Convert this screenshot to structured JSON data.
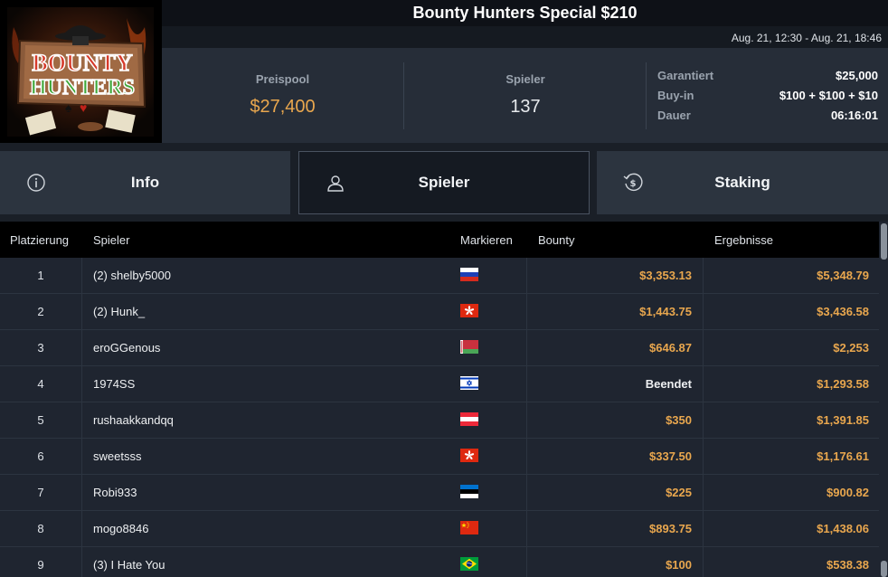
{
  "tournament": {
    "title": "Bounty Hunters Special $210",
    "dates": "Aug. 21, 12:30 - Aug. 21, 18:46",
    "logo_text": "BOUNTY HUNTERS"
  },
  "stats": {
    "prizepool_label": "Preispool",
    "prizepool_value": "$27,400",
    "players_label": "Spieler",
    "players_value": "137"
  },
  "details": [
    {
      "key": "Garantiert",
      "value": "$25,000"
    },
    {
      "key": "Buy-in",
      "value": "$100 + $100 + $10"
    },
    {
      "key": "Dauer",
      "value": "06:16:01"
    }
  ],
  "tabs": [
    {
      "label": "Info",
      "icon": "info-icon"
    },
    {
      "label": "Spieler",
      "icon": "user-icon",
      "active": true
    },
    {
      "label": "Staking",
      "icon": "staking-icon"
    }
  ],
  "table": {
    "headers": {
      "rank": "Platzierung",
      "player": "Spieler",
      "flag": "Markieren",
      "bounty": "Bounty",
      "results": "Ergebnisse"
    },
    "rows": [
      {
        "rank": "1",
        "player": "(2) shelby5000",
        "flag": "russia",
        "bounty": "$3,353.13",
        "result": "$5,348.79"
      },
      {
        "rank": "2",
        "player": "(2) Hunk_",
        "flag": "hong-kong",
        "bounty": "$1,443.75",
        "result": "$3,436.58"
      },
      {
        "rank": "3",
        "player": "eroGGenous",
        "flag": "belarus",
        "bounty": "$646.87",
        "result": "$2,253"
      },
      {
        "rank": "4",
        "player": "1974SS",
        "flag": "israel",
        "bounty": "Beendet",
        "result": "$1,293.58"
      },
      {
        "rank": "5",
        "player": "rushaakkandqq",
        "flag": "austria",
        "bounty": "$350",
        "result": "$1,391.85"
      },
      {
        "rank": "6",
        "player": "sweetsss",
        "flag": "hong-kong",
        "bounty": "$337.50",
        "result": "$1,176.61"
      },
      {
        "rank": "7",
        "player": "Robi933",
        "flag": "estonia",
        "bounty": "$225",
        "result": "$900.82"
      },
      {
        "rank": "8",
        "player": "mogo8846",
        "flag": "china",
        "bounty": "$893.75",
        "result": "$1,438.06"
      },
      {
        "rank": "9",
        "player": "(3) I Hate You",
        "flag": "brazil",
        "bounty": "$100",
        "result": "$538.38"
      }
    ]
  },
  "colors": {
    "accent": "#e9a74e",
    "panel": "#262d38",
    "background": "#1a1f27"
  }
}
